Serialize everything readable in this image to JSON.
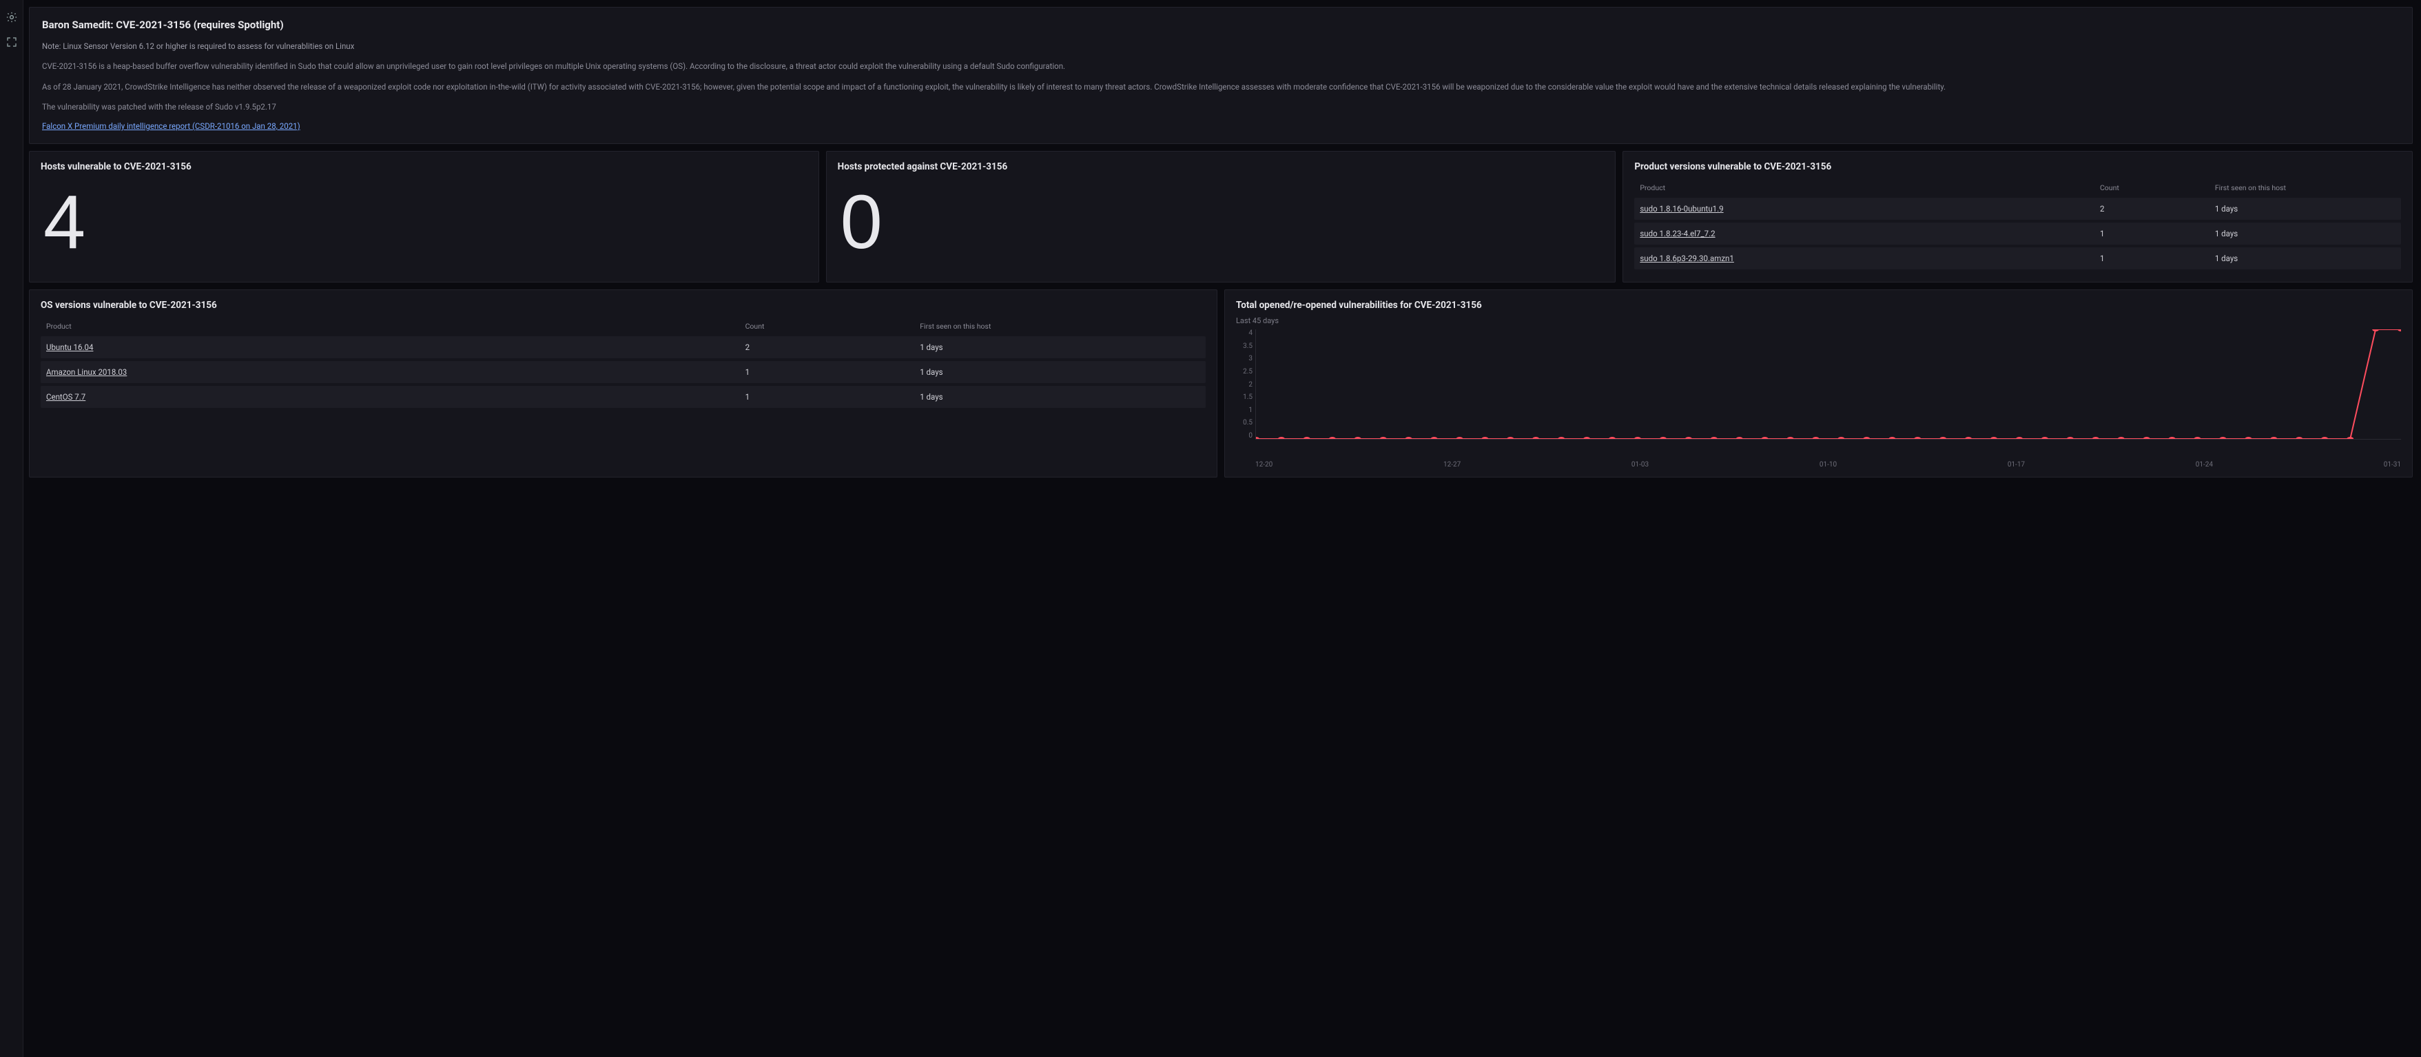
{
  "header": {
    "title": "Baron Samedit: CVE-2021-3156 (requires Spotlight)",
    "note": "Note: Linux Sensor Version 6.12 or higher is required to assess for vulnerablities on Linux",
    "p1": "CVE-2021-3156 is a heap-based buffer overflow vulnerability identified in Sudo that could allow an unprivileged user to gain root level privileges on multiple Unix operating systems (OS). According to the disclosure, a threat actor could exploit the vulnerability using a default Sudo configuration.",
    "p2": "As of 28 January 2021, CrowdStrike Intelligence has neither observed the release of a weaponized exploit code nor exploitation in-the-wild (ITW) for activity associated with CVE-2021-3156; however, given the potential scope and impact of a functioning exploit, the vulnerability is likely of interest to many threat actors. CrowdStrike Intelligence assesses with moderate confidence that CVE-2021-3156 will be weaponized due to the considerable value the exploit would have and the extensive technical details released explaining the vulnerability.",
    "p3": "The vulnerability was patched with the release of Sudo v1.9.5p2.17",
    "link": "Falcon X Premium daily intelligence report (CSDR-21016 on Jan 28, 2021)"
  },
  "stats": {
    "vulnerable": {
      "title": "Hosts vulnerable to CVE-2021-3156",
      "value": "4"
    },
    "protected": {
      "title": "Hosts protected against CVE-2021-3156",
      "value": "0"
    }
  },
  "product_versions": {
    "title": "Product versions vulnerable to CVE-2021-3156",
    "cols": {
      "product": "Product",
      "count": "Count",
      "first_seen": "First seen on this host"
    },
    "rows": [
      {
        "product": "sudo 1.8.16-0ubuntu1.9",
        "count": "2",
        "first_seen": "1 days"
      },
      {
        "product": "sudo 1.8.23-4.el7_7.2",
        "count": "1",
        "first_seen": "1 days"
      },
      {
        "product": "sudo 1.8.6p3-29.30.amzn1",
        "count": "1",
        "first_seen": "1 days"
      }
    ]
  },
  "os_versions": {
    "title": "OS versions vulnerable to CVE-2021-3156",
    "cols": {
      "product": "Product",
      "count": "Count",
      "first_seen": "First seen on this host"
    },
    "rows": [
      {
        "product": "Ubuntu 16.04",
        "count": "2",
        "first_seen": "1 days"
      },
      {
        "product": "Amazon Linux 2018.03",
        "count": "1",
        "first_seen": "1 days"
      },
      {
        "product": "CentOS 7.7",
        "count": "1",
        "first_seen": "1 days"
      }
    ]
  },
  "chart": {
    "title": "Total opened/re-opened vulnerabilities for CVE-2021-3156",
    "subcaption": "Last 45 days",
    "yticks": [
      "4",
      "3.5",
      "3",
      "2.5",
      "2",
      "1.5",
      "1",
      "0.5",
      "0"
    ],
    "xticks": [
      "12-20",
      "12-27",
      "01-03",
      "01-10",
      "01-17",
      "01-24",
      "01-31"
    ]
  },
  "chart_data": {
    "type": "line",
    "title": "Total opened/re-opened vulnerabilities for CVE-2021-3156",
    "subtitle": "Last 45 days",
    "xlabel": "",
    "ylabel": "",
    "ylim": [
      0,
      4
    ],
    "x": [
      "12-18",
      "12-19",
      "12-20",
      "12-21",
      "12-22",
      "12-23",
      "12-24",
      "12-25",
      "12-26",
      "12-27",
      "12-28",
      "12-29",
      "12-30",
      "12-31",
      "01-01",
      "01-02",
      "01-03",
      "01-04",
      "01-05",
      "01-06",
      "01-07",
      "01-08",
      "01-09",
      "01-10",
      "01-11",
      "01-12",
      "01-13",
      "01-14",
      "01-15",
      "01-16",
      "01-17",
      "01-18",
      "01-19",
      "01-20",
      "01-21",
      "01-22",
      "01-23",
      "01-24",
      "01-25",
      "01-26",
      "01-27",
      "01-28",
      "01-29",
      "01-30",
      "01-31",
      "02-01"
    ],
    "values": [
      0,
      0,
      0,
      0,
      0,
      0,
      0,
      0,
      0,
      0,
      0,
      0,
      0,
      0,
      0,
      0,
      0,
      0,
      0,
      0,
      0,
      0,
      0,
      0,
      0,
      0,
      0,
      0,
      0,
      0,
      0,
      0,
      0,
      0,
      0,
      0,
      0,
      0,
      0,
      0,
      0,
      0,
      0,
      0,
      4,
      4
    ]
  }
}
